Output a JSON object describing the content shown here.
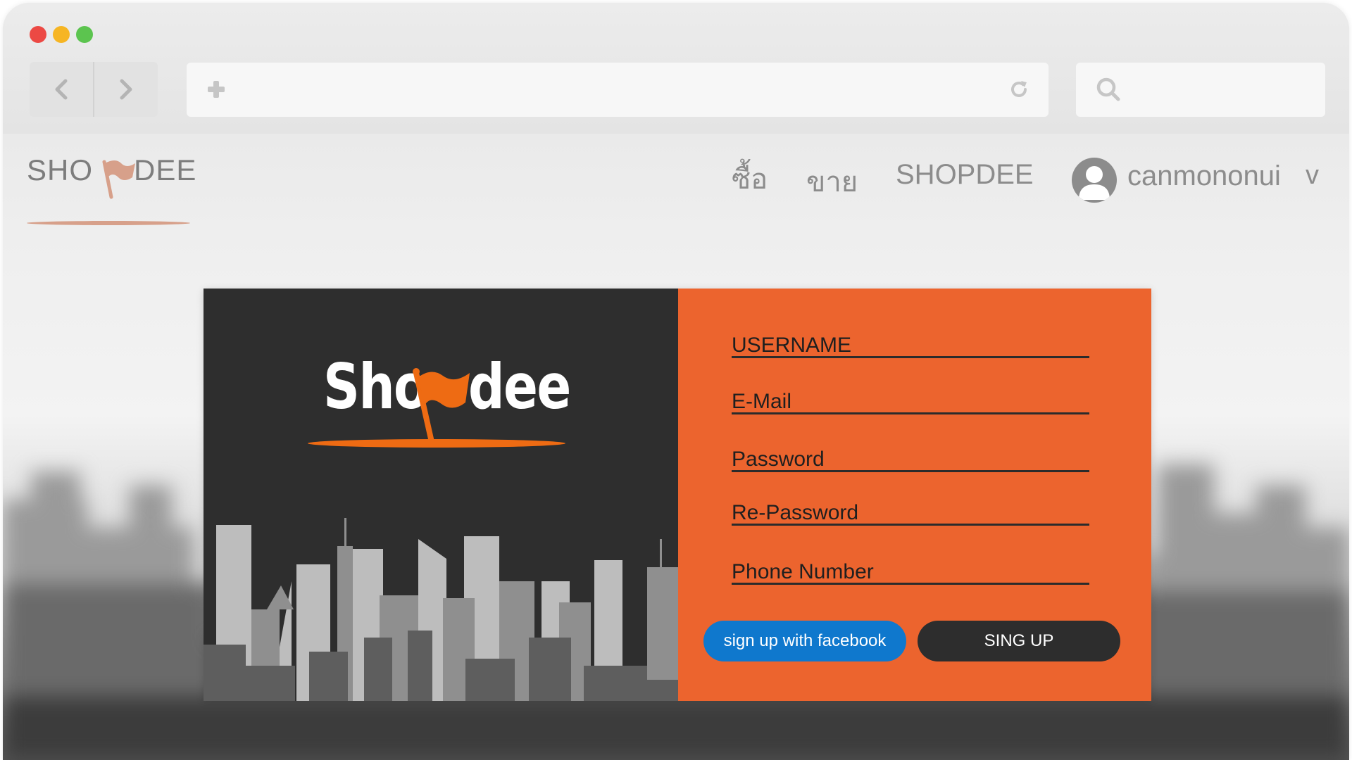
{
  "browser": {
    "url": "",
    "search": ""
  },
  "site": {
    "logo_left": "SHO",
    "logo_right": "DEE",
    "nav": {
      "buy": "ซื้อ",
      "sell": "ขาย",
      "brand": "SHOPDEE"
    },
    "user": {
      "name": "canmononui",
      "caret": "v"
    }
  },
  "card": {
    "brand_left": "Sho",
    "brand_right": "dee",
    "fields": {
      "username": "USERNAME",
      "email": "E-Mail",
      "password": "Password",
      "repassword": "Re-Password",
      "phone": "Phone Number"
    },
    "buttons": {
      "facebook": "sign up with facebook",
      "signup": "SING UP"
    }
  },
  "colors": {
    "accent_orange": "#ec642e",
    "dark_panel": "#2e2e2e",
    "facebook_blue": "#0f78cd",
    "logo_orange": "#ee6b13"
  }
}
